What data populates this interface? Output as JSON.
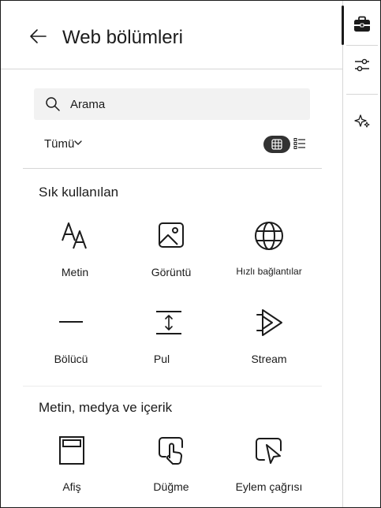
{
  "header": {
    "title": "Web bölümleri",
    "back_icon": "arrow-left-icon"
  },
  "search": {
    "placeholder": "Arama",
    "value": ""
  },
  "filter": {
    "label": "Tümü"
  },
  "view": {
    "grid_icon": "grid-view-icon",
    "list_icon": "list-view-icon"
  },
  "sections": [
    {
      "title": "Sık kullanılan",
      "items": [
        {
          "label": "Metin",
          "icon": "text-icon"
        },
        {
          "label": "Görüntü",
          "icon": "image-icon"
        },
        {
          "label": "Hızlı bağlantılar",
          "icon": "globe-icon"
        },
        {
          "label": "Bölücü",
          "icon": "divider-icon"
        },
        {
          "label": "Pul",
          "icon": "spacer-icon"
        },
        {
          "label": "Stream",
          "icon": "stream-icon"
        }
      ]
    },
    {
      "title": "Metin, medya ve içerik",
      "items": [
        {
          "label": "Afiş",
          "icon": "banner-icon"
        },
        {
          "label": "Düğme",
          "icon": "button-icon"
        },
        {
          "label": "Eylem çağrısı",
          "icon": "call-to-action-icon"
        }
      ]
    }
  ],
  "rail": {
    "items": [
      "toolbox-icon",
      "settings-sliders-icon",
      "sparkle-icon"
    ]
  },
  "colors": {
    "accent": "#1b1b1b",
    "toggle_bg": "#323232",
    "search_bg": "#f2f2f2",
    "divider": "#d6d6d6"
  }
}
